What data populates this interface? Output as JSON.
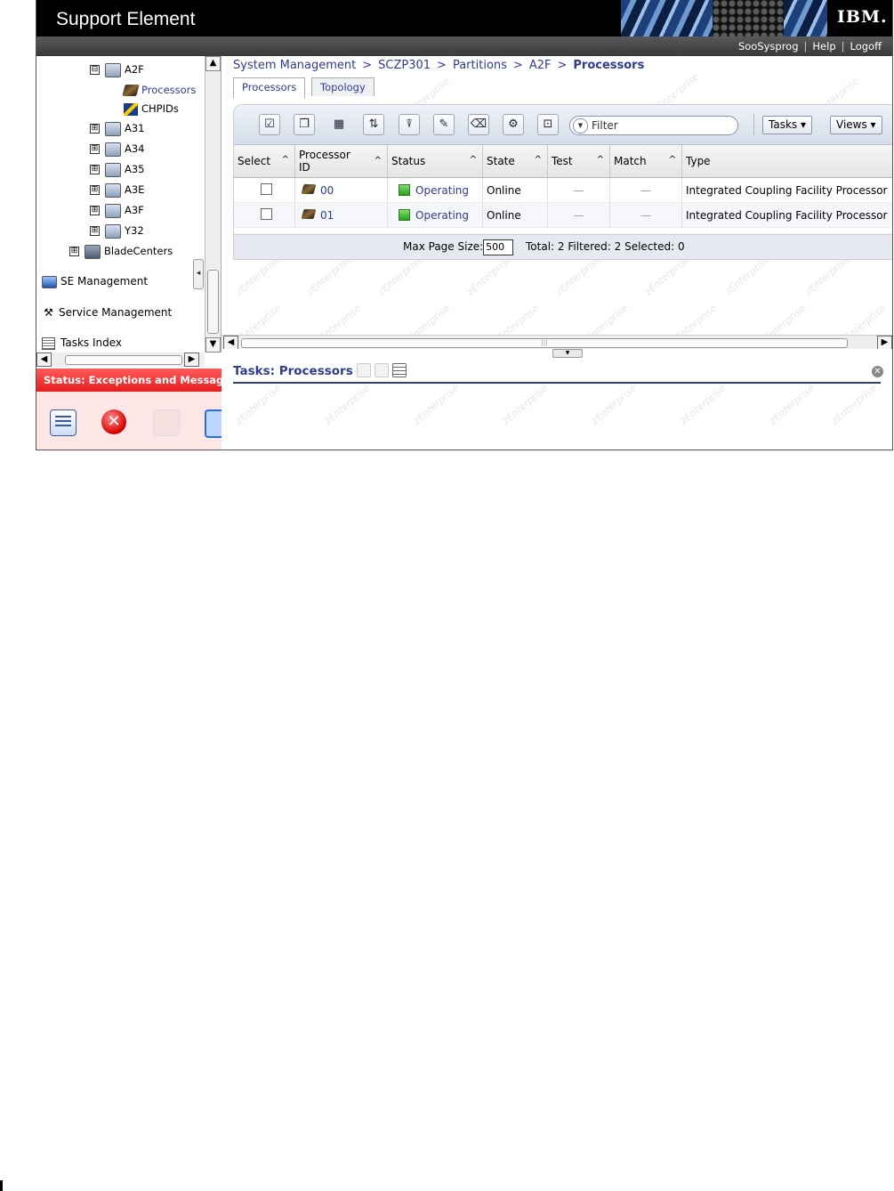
{
  "banner": {
    "title": "Support Element",
    "logo": "IBM."
  },
  "userbar": {
    "user": "SooSysprog",
    "help": "Help",
    "logoff": "Logoff"
  },
  "nav": {
    "tree": [
      {
        "label": "A2F",
        "expander": "⊟",
        "icon": "partition-icon",
        "selected": false
      },
      {
        "label": "Processors",
        "icon": "processor-icon",
        "selected": true
      },
      {
        "label": "CHPIDs",
        "icon": "chpid-icon",
        "selected": false
      },
      {
        "label": "A31",
        "expander": "⊞",
        "icon": "partition-icon"
      },
      {
        "label": "A34",
        "expander": "⊞",
        "icon": "partition-icon"
      },
      {
        "label": "A35",
        "expander": "⊞",
        "icon": "partition-icon"
      },
      {
        "label": "A3E",
        "expander": "⊞",
        "icon": "partition-icon"
      },
      {
        "label": "A3F",
        "expander": "⊞",
        "icon": "partition-icon"
      },
      {
        "label": "Y32",
        "expander": "⊞",
        "icon": "partition-icon"
      },
      {
        "label": "BladeCenters",
        "expander": "⊞",
        "icon": "bladecenter-icon"
      }
    ],
    "sections": [
      {
        "label": "SE Management",
        "icon": "se-management-icon"
      },
      {
        "label": "Service Management",
        "icon": "service-management-icon"
      },
      {
        "label": "Tasks Index",
        "icon": "tasks-index-icon"
      }
    ],
    "status": "Status: Exceptions and Messages"
  },
  "breadcrumb": [
    "System Management",
    "SCZP301",
    "Partitions",
    "A2F",
    "Processors"
  ],
  "tabs": [
    "Processors",
    "Topology"
  ],
  "toolbar": {
    "filter_placeholder": "Filter",
    "tasks_label": "Tasks ▾",
    "views_label": "Views ▾"
  },
  "table": {
    "columns": [
      "Select",
      "Processor ID",
      "Status",
      "State",
      "Test",
      "Match",
      "Type"
    ],
    "rows": [
      {
        "id": "00",
        "status": "Operating",
        "state": "Online",
        "test": "—",
        "match": "—",
        "type": "Integrated Coupling Facility Processor"
      },
      {
        "id": "01",
        "status": "Operating",
        "state": "Online",
        "test": "—",
        "match": "—",
        "type": "Integrated Coupling Facility Processor"
      }
    ],
    "footer": {
      "max_page_label": "Max Page Size:",
      "max_page_value": "500",
      "totals": "Total: 2   Filtered: 2   Selected: 0"
    }
  },
  "tasks": {
    "title": "Tasks: Processors"
  },
  "colors": {
    "accent": "#2f3c8d",
    "status_red": "#e71d1d",
    "operating_green": "#2a9e20"
  }
}
